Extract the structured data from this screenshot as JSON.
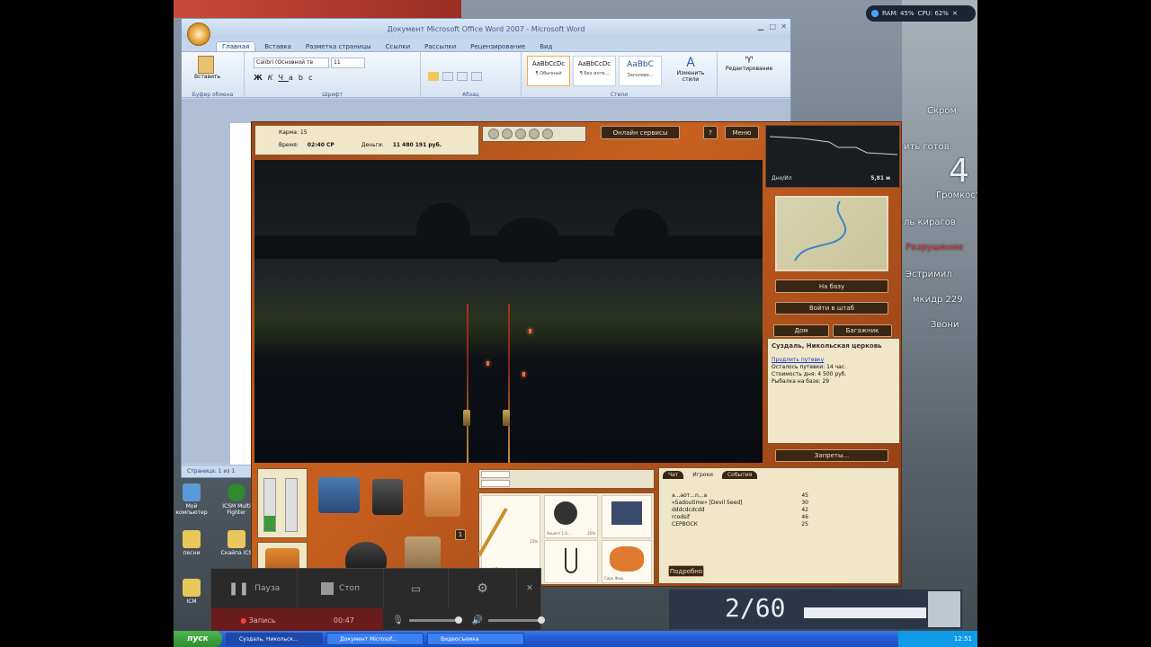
{
  "desktop": {
    "icons": [
      {
        "label": "Мой компьютер"
      },
      {
        "label": "ICSM Multi Fighter"
      },
      {
        "label": "песни"
      },
      {
        "label": "Скайпа ICS"
      },
      {
        "label": "ICM"
      }
    ],
    "perf": {
      "ram": "RAM: 45%",
      "cpu": "CPU: 62%"
    },
    "overlay": [
      "Скром",
      "ить готов",
      "Громкость",
      "ль кирагов",
      "Разрушение",
      "Эстримил",
      "мкидр 229",
      "Звони"
    ],
    "overlay_big": "4"
  },
  "word": {
    "title": "Документ Microsoft Office Word 2007 - Microsoft Word",
    "tabs": [
      "Главная",
      "Вставка",
      "Разметка страницы",
      "Ссылки",
      "Рассылки",
      "Рецензирование",
      "Вид"
    ],
    "active_tab": "Главная",
    "font_name": "Calibri (Основной те",
    "font_size": "11",
    "paste_label": "Вставить",
    "groups": [
      "Буфер обмена",
      "Шрифт",
      "Абзац",
      "Стили",
      "Редактирование"
    ],
    "styles": [
      {
        "sample": "AaBbCcDc",
        "name": "¶ Обычный"
      },
      {
        "sample": "AaBbCcDc",
        "name": "¶ Без инте..."
      },
      {
        "sample": "AaBbC",
        "name": "Заголово..."
      }
    ],
    "change_styles": "Изменить стили",
    "editing": "Редактирование",
    "status": "Страница: 1 из 1"
  },
  "game": {
    "stats": {
      "label1": "Карма: 15",
      "time_label": "Время:",
      "time": "02:40 СР",
      "money_label": "Деньги:",
      "money": "11 480 191 руб."
    },
    "online_services": "Онлайн сервисы",
    "help": "?",
    "menu": "Меню",
    "depth": "5,81 м",
    "depth_bottom": "Дно/Ил",
    "to_base": "На базу",
    "enter_hq": "Войти в штаб",
    "home": "Дом",
    "baggage": "Багажник",
    "location": {
      "title": "Суздаль, Никольская церковь",
      "link": "Продлить путевку",
      "lines": [
        "Осталось путевки: 14 час.",
        "Стоимость дня: 4 500 руб.",
        "Рыбалка на базе: 29"
      ]
    },
    "bans": "Запреты...",
    "tackle": {
      "line_label": "Leo8 Fish",
      "line_length": "300 м",
      "percent1": "23%",
      "percent2": "26%",
      "reel_label": "Акцент 1.6...",
      "bait_label": "Сиро Фиш",
      "slot_num": "1"
    },
    "chat": {
      "tabs": [
        "Чат",
        "Игроки",
        "События"
      ],
      "active_tab": "Игроки",
      "players": [
        {
          "name": "a...аот...n...a",
          "level": "45"
        },
        {
          "name": "«Sadoutime» [Devil Seed]",
          "level": "30"
        },
        {
          "name": "dddcdcdcdd",
          "level": "42"
        },
        {
          "name": "rcodsif",
          "level": "46"
        },
        {
          "name": "СЕРВОСК",
          "level": "25"
        }
      ],
      "button": "Подробно"
    }
  },
  "recorder": {
    "pause": "Пауза",
    "stop": "Стоп",
    "record": "Запись",
    "time": "00:47"
  },
  "hud": {
    "ammo": "2/60"
  },
  "taskbar": {
    "start": "пуск",
    "tasks": [
      "Суздаль, Никольск...",
      "Документ Microsof...",
      "Видеосъемка"
    ],
    "clock": "12:51"
  }
}
